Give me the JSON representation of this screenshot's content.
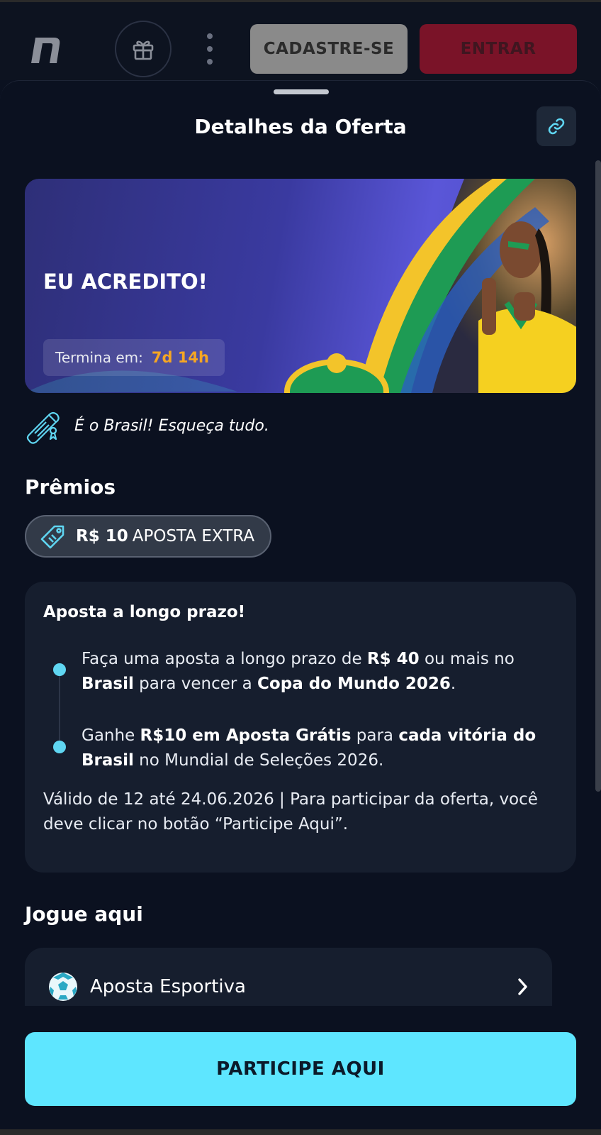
{
  "header": {
    "register_label": "CADASTRE-SE",
    "login_label": "ENTRAR"
  },
  "sheet": {
    "title": "Detalhes da Oferta"
  },
  "banner": {
    "title": "EU ACREDITO!",
    "timer_label": "Termina em:",
    "timer_value": "7d 14h"
  },
  "tagline": "É o Brasil! Esqueça tudo.",
  "prizes": {
    "title": "Prêmios",
    "amount": "R$ 10",
    "label": "APOSTA EXTRA"
  },
  "info": {
    "title": "Aposta a longo prazo!",
    "step1": {
      "p1": "Faça uma aposta a longo prazo de ",
      "b1": "R$ 40",
      "p2": " ou mais no ",
      "b2": "Brasil",
      "p3": " para vencer a ",
      "b3": "Copa do Mundo 2026",
      "p4": "."
    },
    "step2": {
      "p1": "Ganhe ",
      "b1": "R$10 em Aposta Grátis",
      "p2": " para ",
      "b2": "cada vitória do Brasil",
      "p3": " no Mundial de Seleções 2026."
    },
    "validity": "Válido de 12 até 24.06.2026 | Para participar da oferta, você deve clicar no botão “Participe Aqui”."
  },
  "play": {
    "title": "Jogue aqui",
    "item_label": "Aposta Esportiva"
  },
  "cta_label": "PARTICIPE AQUI",
  "colors": {
    "accent_cyan": "#5ee6ff",
    "timer_orange": "#f5a623",
    "login_red": "#7a1328"
  },
  "icons": [
    "brand-logo-icon",
    "gift-icon",
    "more-vertical-icon",
    "link-icon",
    "scroll-icon",
    "ticket-icon",
    "soccer-ball-icon",
    "chevron-right-icon"
  ]
}
